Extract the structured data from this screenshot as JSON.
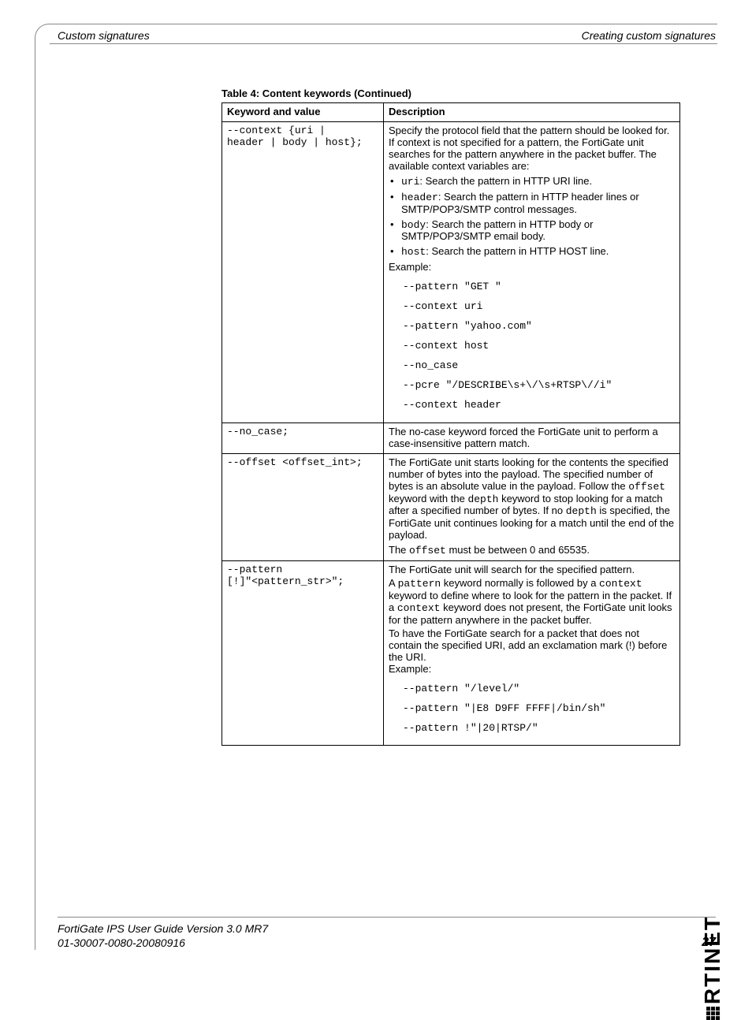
{
  "header": {
    "left": "Custom signatures",
    "right": "Creating custom signatures"
  },
  "table": {
    "caption": "Table 4: Content keywords (Continued)",
    "head": {
      "c1": "Keyword and value",
      "c2": "Description"
    },
    "r1": {
      "kw_l1": "--context {uri |",
      "kw_l2": "header | body | host};",
      "intro": "Specify the protocol field that the pattern should be looked for. If context is not specified for a pattern, the FortiGate unit searches for the pattern anywhere in the packet buffer. The available context variables are:",
      "b1a": "uri",
      "b1b": ": Search the pattern in HTTP URI line.",
      "b2a": "header",
      "b2b": ": Search the pattern in HTTP header lines or SMTP/POP3/SMTP control messages.",
      "b3a": "body",
      "b3b": ": Search the pattern in HTTP body or SMTP/POP3/SMTP email body.",
      "b4a": "host",
      "b4b": ": Search the pattern in HTTP HOST line.",
      "example_label": "Example:",
      "ex1": "--pattern \"GET \"",
      "ex2": "--context uri",
      "ex3": "--pattern \"yahoo.com\"",
      "ex4": "--context host",
      "ex5": "--no_case",
      "ex6": "--pcre \"/DESCRIBE\\s+\\/\\s+RTSP\\//i\"",
      "ex7": "--context header"
    },
    "r2": {
      "kw": "--no_case;",
      "desc": "The no-case keyword forced the FortiGate unit to perform a case-insensitive pattern match."
    },
    "r3": {
      "kw": "--offset <offset_int>;",
      "d1a": "The FortiGate unit starts looking for the contents the specified number of bytes into the payload. The specified number of bytes is an absolute value in the payload. Follow the ",
      "d1b": "offset",
      "d1c": " keyword with the ",
      "d1d": "depth",
      "d1e": " keyword to stop looking for a match after a specified number of bytes. If no ",
      "d1f": "depth",
      "d1g": " is specified, the FortiGate unit continues looking for a match until the end of the payload.",
      "d2a": "The ",
      "d2b": "offset",
      "d2c": " must be between 0 and 65535."
    },
    "r4": {
      "kw_l1": "--pattern",
      "kw_l2": "[!]\"<pattern_str>\";",
      "p1": "The FortiGate unit will search for the specified pattern.",
      "p2a": "A ",
      "p2b": "pattern",
      "p2c": " keyword normally is followed by a ",
      "p2d": "context",
      "p2e": " keyword to define where to look for the pattern in the packet. If a ",
      "p2f": "context",
      "p2g": " keyword does not present, the FortiGate unit looks for the pattern anywhere in the packet buffer.",
      "p3": "To have the FortiGate search for a packet that does not contain the specified URI, add an exclamation mark (!) before the URI.",
      "example_label": "Example:",
      "ex1": "--pattern \"/level/\"",
      "ex2": "--pattern \"|E8 D9FF FFFF|/bin/sh\"",
      "ex3": "--pattern !\"|20|RTSP/\""
    }
  },
  "footer": {
    "line1": "FortiGate IPS User Guide Version 3.0 MR7",
    "line2": "01-30007-0080-20080916",
    "page": "27"
  },
  "brand": "RTINET"
}
